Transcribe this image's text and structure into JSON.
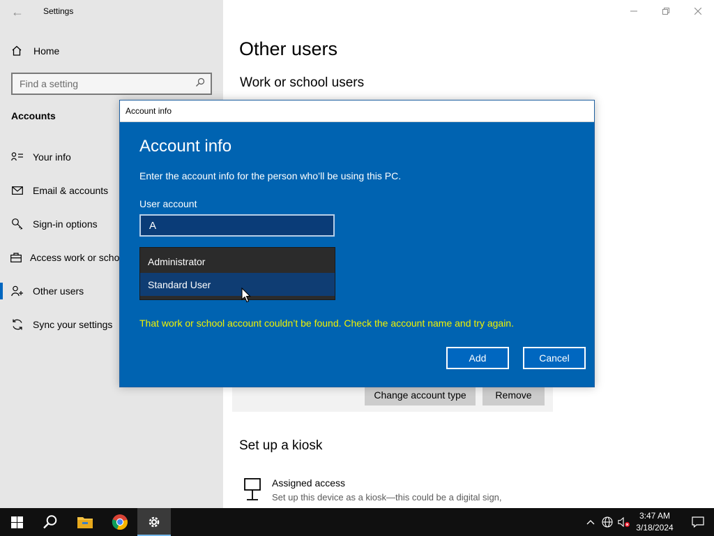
{
  "app": {
    "title": "Settings"
  },
  "sidebar": {
    "home_label": "Home",
    "search_placeholder": "Find a setting",
    "section_label": "Accounts",
    "items": [
      {
        "label": "Your info",
        "icon": "person-info-icon"
      },
      {
        "label": "Email & accounts",
        "icon": "mail-icon"
      },
      {
        "label": "Sign-in options",
        "icon": "key-icon"
      },
      {
        "label": "Access work or school",
        "icon": "briefcase-icon"
      },
      {
        "label": "Other users",
        "icon": "person-add-icon",
        "selected": true
      },
      {
        "label": "Sync your settings",
        "icon": "sync-icon"
      }
    ]
  },
  "main": {
    "title": "Other users",
    "work_school_title": "Work or school users",
    "change_account_type_label": "Change account type",
    "remove_label": "Remove",
    "kiosk_title": "Set up a kiosk",
    "assigned_access_title": "Assigned access",
    "assigned_access_desc": "Set up this device as a kiosk—this could be a digital sign,"
  },
  "dialog": {
    "window_title": "Account info",
    "heading": "Account info",
    "description": "Enter the account info for the person who’ll be using this PC.",
    "field_label": "User account",
    "field_value": "A",
    "dropdown_options": [
      "Administrator",
      "Standard User"
    ],
    "hovered_option": "Standard User",
    "error_message": "That work or school account couldn’t be found. Check the account name and try again.",
    "add_label": "Add",
    "cancel_label": "Cancel",
    "accent_color": "#0063b1",
    "error_color": "#f2f200"
  },
  "taskbar": {
    "time": "3:47 AM",
    "date": "3/18/2024",
    "apps": [
      "windows-start-icon",
      "search-icon",
      "file-explorer-icon",
      "chrome-icon",
      "settings-icon"
    ]
  }
}
